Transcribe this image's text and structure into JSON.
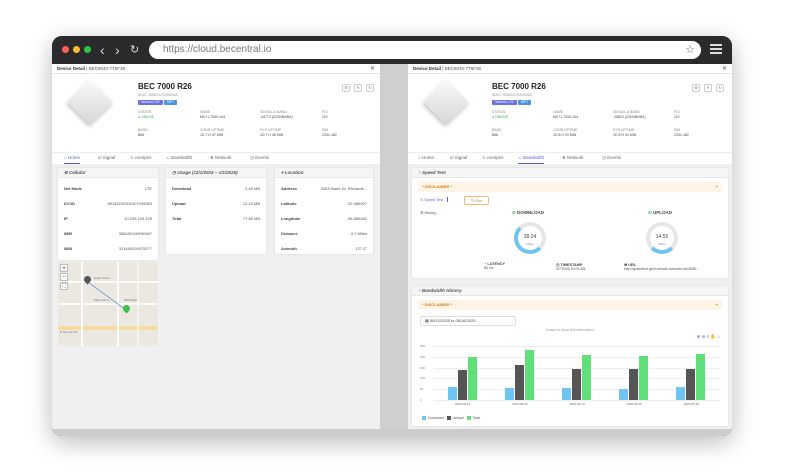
{
  "browser": {
    "url": "https://cloud.becentral.io"
  },
  "left": {
    "title": "Device Detail",
    "title_sub": "| BEC8040-7T6F38",
    "device": {
      "name": "BEC 7000 R26",
      "mac": "MAC: 6B6547D09A9A",
      "tag1": "Verizon LTE",
      "tag2": "MFT"
    },
    "info": [
      {
        "label": "STATUS",
        "value": "ONLINE"
      },
      {
        "label": "NAME",
        "value": "MX7-L7000-104"
      },
      {
        "label": "SIGNAL & BAND",
        "value": "-44773 (2200/B4/B4)"
      },
      {
        "label": "PCI",
        "value": "119"
      },
      {
        "label": "BAND",
        "value": "B66"
      },
      {
        "label": "CONN UPTIME",
        "value": "1D 7 H 37 MIN"
      },
      {
        "label": "SYS UPTIME",
        "value": "1D 7 H 48 MIN"
      },
      {
        "label": "SIM",
        "value": "1331-182"
      }
    ],
    "tabs": [
      "Home",
      "Signal",
      "Analysis",
      "Bandwidth",
      "Network",
      "Events"
    ],
    "cellular": {
      "title": "Cellular",
      "rows": [
        {
          "k": "Net Mode",
          "v": "LTE"
        },
        {
          "k": "ICCID",
          "v": "89148220302407049963"
        },
        {
          "k": "IP",
          "v": "10.226.153.126"
        },
        {
          "k": "IMEI",
          "v": "356289100930467"
        },
        {
          "k": "IMSI",
          "v": "311480029475277"
        }
      ]
    },
    "usage": {
      "title": "Usage (12/1/2024 ~ 1/1/2025)",
      "rows": [
        {
          "k": "Download",
          "v": "5.45 MB"
        },
        {
          "k": "Upload",
          "v": "12.43 MB"
        },
        {
          "k": "Total",
          "v": "77.89 MB"
        }
      ]
    },
    "location": {
      "title": "Location",
      "rows": [
        {
          "k": "Address",
          "v": "3303 Marie Dr, Richards..."
        },
        {
          "k": "Latitude",
          "v": "32.986007"
        },
        {
          "k": "Longitude",
          "v": "-96.885482"
        },
        {
          "k": "Distance",
          "v": "0.2 Miles"
        },
        {
          "k": "Azimuth",
          "v": "127.2°"
        }
      ]
    },
    "map": {
      "street1": "Eagle Drive",
      "street2": "Marie Drive",
      "street3": "E Renner Rd",
      "street4": "Mill Ridge",
      "zoom_in": "+",
      "zoom_out": "−"
    }
  },
  "right": {
    "title": "Device Detail",
    "title_sub": "| BEC8040-7T6F38",
    "device": {
      "name": "BEC 7000 R26",
      "mac": "MAC: 6B6547D09A9A",
      "tag1": "Verizon LTE",
      "tag2": "MFT"
    },
    "info": [
      {
        "label": "STATUS",
        "value": "ONLINE"
      },
      {
        "label": "NAME",
        "value": "MX7-L7000-104"
      },
      {
        "label": "SIGNAL & BAND",
        "value": "-15822 (2200/B4/B4)"
      },
      {
        "label": "PCI",
        "value": "110"
      },
      {
        "label": "BAND",
        "value": "B66"
      },
      {
        "label": "CONN UPTIME",
        "value": "1D 8 H 23 MIN"
      },
      {
        "label": "SYS UPTIME",
        "value": "1D 8 H 34 MIN"
      },
      {
        "label": "SIM",
        "value": "1331-182"
      }
    ],
    "tabs": [
      "Home",
      "Signal",
      "Analysis",
      "Bandwidth",
      "Network",
      "Events"
    ],
    "speed": {
      "title": "Speed Test",
      "disclaimer": "* DISCLAIMER *",
      "btn_speed": "Speed Test",
      "btn_run": "Run",
      "history": "History",
      "download_label": "DOWNLOAD",
      "download_value": "38.24",
      "download_unit": "Mbps",
      "download_fraction": 0.6,
      "upload_label": "UPLOAD",
      "upload_value": "14.55",
      "upload_unit": "Mbps",
      "upload_fraction": 0.3,
      "latency_label": "LATENCY",
      "latency_value": "86 ms",
      "timestamp_label": "TIMESTAMP",
      "timestamp_value": "4/7/2025 10:03 AM",
      "url_label": "URL",
      "url_value": "http://speedtest.gstrl.newark.comcast.net:8080..."
    },
    "bandwidth": {
      "title": "Bandwidth History",
      "disclaimer": "* DISCLAIMER *",
      "date_range": "05/12/2025 to 05/16/2025",
      "drag_hint": "Drawn to show this information",
      "legend_download": "Download",
      "legend_upload": "Upload",
      "legend_total": "Total"
    }
  },
  "chart_data": {
    "type": "bar",
    "categories": [
      "2025-05-12",
      "2025-05-13",
      "2025-05-14",
      "2025-05-15",
      "2025-05-16"
    ],
    "series": [
      {
        "name": "Download",
        "values": [
          60,
          55,
          55,
          52,
          62
        ],
        "color": "#6ec4f2"
      },
      {
        "name": "Upload",
        "values": [
          140,
          160,
          145,
          145,
          145
        ],
        "color": "#555555"
      },
      {
        "name": "Total",
        "values": [
          200,
          230,
          210,
          205,
          215
        ],
        "color": "#5fe07a"
      }
    ],
    "ylim": [
      0,
      250
    ],
    "yticks": [
      0,
      50,
      100,
      150,
      200,
      250
    ]
  },
  "colors": {
    "accent": "#5a5fd6",
    "online": "#2bb24c",
    "warning": "#d97a1a"
  }
}
